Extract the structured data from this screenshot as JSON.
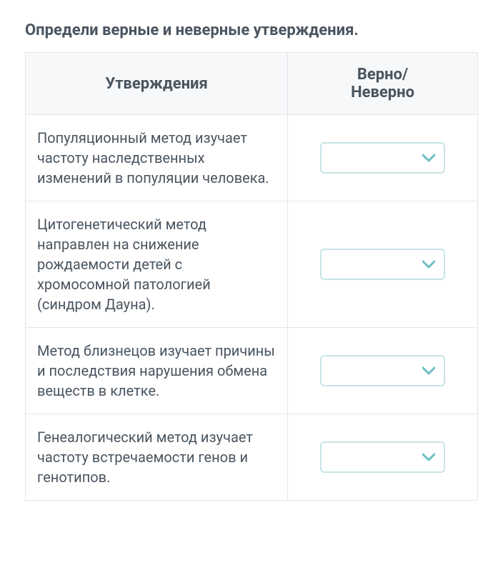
{
  "title": "Определи верные и неверные утверждения.",
  "headers": {
    "statements": "Утверждения",
    "truefalse": "Верно/\nНеверно"
  },
  "rows": [
    {
      "statement": "Популяционный метод изучает частоту наследственных изменений в популяции человека.",
      "selected": ""
    },
    {
      "statement": "Цитогенетический метод направлен на снижение рождаемости детей с хромосомной патологией (синдром Дауна).",
      "selected": ""
    },
    {
      "statement": "Метод близнецов изучает причины и последствия нарушения обмена веществ в клетке.",
      "selected": ""
    },
    {
      "statement": "Генеалогический метод изучает частоту встречаемости генов и генотипов.",
      "selected": ""
    }
  ],
  "colors": {
    "text": "#4a5560",
    "border": "#e3e6e9",
    "headerBg": "#f7f8f9",
    "dropdownBorder": "#c8e4e6",
    "chevron": "#6bbfc4"
  }
}
